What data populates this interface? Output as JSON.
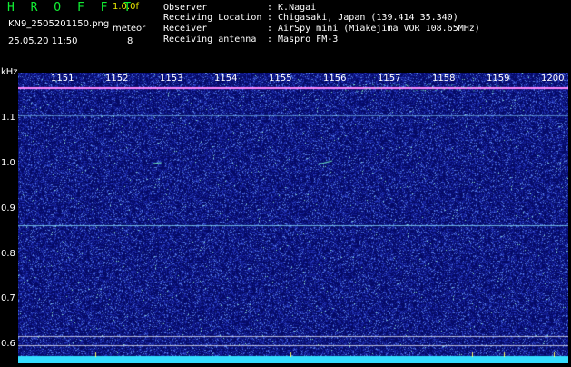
{
  "header": {
    "app_name": "H R O F F T",
    "version": "1.0.0f",
    "filename": "KN9_2505201150.png",
    "mode_label": "meteor",
    "datetime": "25.05.20 11:50",
    "meteor_count": "8"
  },
  "station": [
    {
      "label": "Observer",
      "value": ": K.Nagai"
    },
    {
      "label": "Receiving Location",
      "value": ": Chigasaki, Japan (139.414 35.340)"
    },
    {
      "label": "Receiver",
      "value": ": AirSpy mini (Miakejima VOR 108.65MHz)"
    },
    {
      "label": "Receiving antenna",
      "value": ": Maspro FM-3"
    }
  ],
  "axes": {
    "y_unit": "kHz",
    "x_ticks": [
      "1151",
      "1152",
      "1153",
      "1154",
      "1155",
      "1156",
      "1157",
      "1158",
      "1159",
      "1200"
    ],
    "y_ticks": [
      "1.1",
      "1.0",
      "0.9",
      "0.8",
      "0.7",
      "0.6"
    ]
  },
  "colors": {
    "background": "#050a66",
    "carrier": "#ff88ff",
    "signal": "#66ddff",
    "baseline": "#33ddff"
  }
}
